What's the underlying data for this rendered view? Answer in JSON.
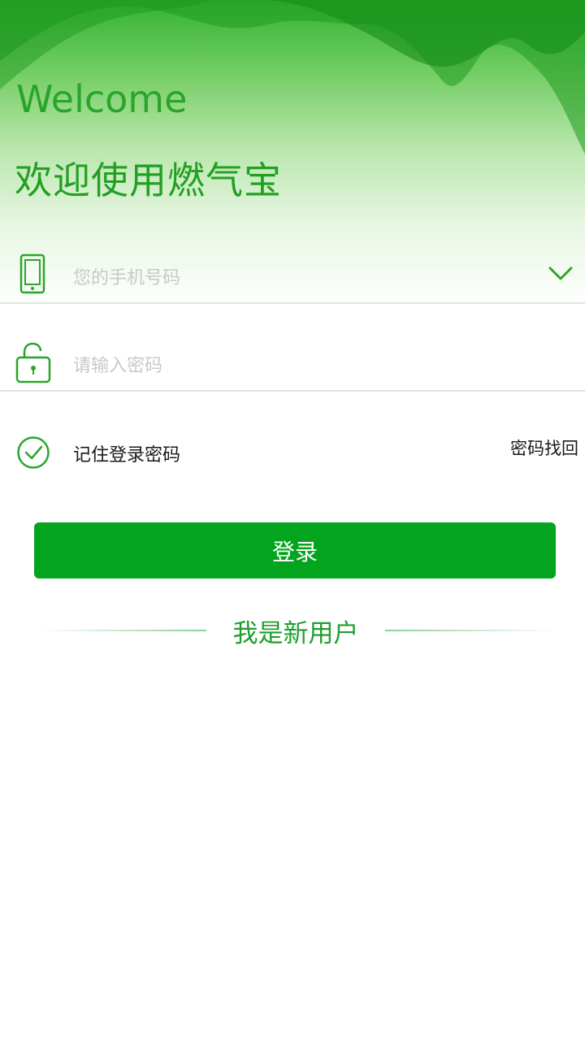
{
  "header": {
    "welcome": "Welcome",
    "app_title": "欢迎使用燃气宝"
  },
  "phone_field": {
    "placeholder": "您的手机号码",
    "value": "",
    "icon": "phone-icon",
    "dropdown_icon": "chevron-down-icon"
  },
  "password_field": {
    "placeholder": "请输入密码",
    "value": "",
    "icon": "unlock-icon"
  },
  "remember": {
    "label": "记住登录密码",
    "checked": true,
    "icon": "check-circle-icon"
  },
  "forgot_password": {
    "label": "密码找回"
  },
  "login_button": {
    "label": "登录"
  },
  "new_user": {
    "label": "我是新用户"
  },
  "colors": {
    "primary": "#04a51e",
    "accent_text": "#1f9e2e",
    "placeholder": "#c8c8c8",
    "divider": "#e2e2e2"
  }
}
